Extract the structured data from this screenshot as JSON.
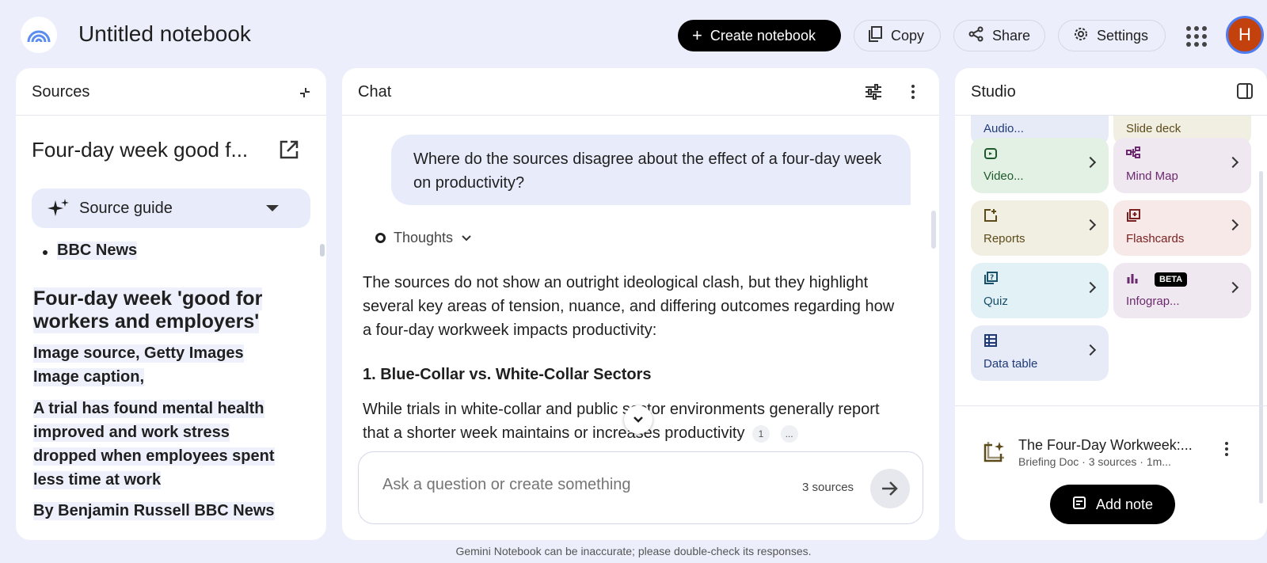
{
  "header": {
    "title": "Untitled notebook",
    "create_label": "Create notebook",
    "copy_label": "Copy",
    "share_label": "Share",
    "settings_label": "Settings",
    "avatar_initial": "H",
    "accent": "#000000"
  },
  "sources": {
    "title": "Sources",
    "doc_title": "Four-day week good f...",
    "guide_label": "Source guide",
    "bullet": "BBC News",
    "headline_1": "Four-day week 'good for",
    "headline_2": "workers and employers'",
    "line_1": "Image source, Getty Images",
    "line_2": "Image caption,",
    "para_1": "A trial has found mental health",
    "para_2": "improved and work stress",
    "para_3": "dropped when employees spent",
    "para_4": "less time at work",
    "byline": "By Benjamin Russell BBC News"
  },
  "chat": {
    "title": "Chat",
    "user_message": "Where do the sources disagree about the effect of a four-day week on productivity?",
    "thoughts_label": "Thoughts",
    "answer_intro": "The sources do not show an outright ideological clash, but they highlight several key areas of tension, nuance, and differing outcomes regarding how a four-day workweek impacts productivity:",
    "section_heading": "1. Blue-Collar vs. White-Collar Sectors",
    "answer_p2_a": "While trials in white-collar and public sector environments generally report that a shorter week maintains or increases productivity",
    "citation_1": "1",
    "citation_2": "...",
    "composer_placeholder": "Ask a question or create something",
    "source_count": "3 sources",
    "disclaimer": "Gemini Notebook can be inaccurate; please double-check its responses."
  },
  "studio": {
    "title": "Studio",
    "partial_tiles": [
      "Audio...",
      "Slide deck"
    ],
    "tiles": [
      {
        "label": "Video...",
        "bg": "#e3f1e5",
        "color": "#1e5a2c",
        "icon": "video-icon"
      },
      {
        "label": "Mind Map",
        "bg": "#f0e8f1",
        "color": "#6b2a6d",
        "icon": "mind-map-icon"
      },
      {
        "label": "Reports",
        "bg": "#f1efe2",
        "color": "#5c4a1a",
        "icon": "reports-icon"
      },
      {
        "label": "Flashcards",
        "bg": "#f6e9e8",
        "color": "#7a2020",
        "icon": "flashcards-icon"
      },
      {
        "label": "Quiz",
        "bg": "#e2f1f6",
        "color": "#17506a",
        "icon": "quiz-icon"
      },
      {
        "label": "Infograp...",
        "bg": "#f0e8f1",
        "color": "#6b2a6d",
        "icon": "infographic-icon"
      },
      {
        "label": "Data table",
        "bg": "#e6ebf7",
        "color": "#203a78",
        "icon": "data-table-icon"
      }
    ],
    "beta_label": "BETA",
    "note_title": "The Four-Day Workweek:...",
    "note_meta": "Briefing Doc · 3 sources · 1m...",
    "add_note_label": "Add note"
  }
}
